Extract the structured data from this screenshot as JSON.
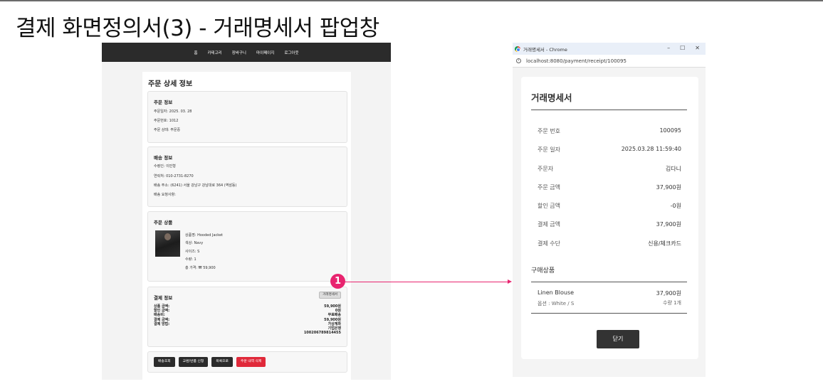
{
  "slide_title": "결제 화면정의서(3) - 거래명세서 팝업창",
  "order_page": {
    "nav": [
      "홈",
      "카테고리",
      "장바구니",
      "마이페이지",
      "로그아웃"
    ],
    "title": "주문 상세 정보",
    "order_info": {
      "title": "주문 정보",
      "lines": [
        "주문일자: 2025. 03. 28",
        "주문번호: 1012",
        "주문 상태: 주문중"
      ]
    },
    "delivery_info": {
      "title": "배송 정보",
      "lines": [
        "수령인: 이민형",
        "연락처: 010-2731-8270",
        "배송 주소: (6241) 서울 강남구 강남대로 364 (역삼동)",
        "배송 요청사항:"
      ]
    },
    "products": {
      "title": "주문 상품",
      "lines": [
        "상품명: Hooded Jacket",
        "색상: Navy",
        "사이즈: S",
        "수량: 1",
        "총 가격: ₩ 59,900"
      ]
    },
    "payment_info": {
      "title": "결제 정보",
      "receipt_button": "거래명세서",
      "labels": [
        "상품 금액:",
        "할인 금액:",
        "배송비:",
        "결제 금액:",
        "결제 방법:"
      ],
      "values": [
        "59,900원",
        "0원",
        "무료배송",
        "59,900원",
        "가상계좌",
        "기업은행",
        "100206789814455"
      ]
    },
    "buttons": [
      "배송조회",
      "교환/반품 신청",
      "목록으로",
      "주문 내역 삭제"
    ]
  },
  "annotation": {
    "badge": "1",
    "color": "#e8246f"
  },
  "popup": {
    "window_title": "거래명세서 - Chrome",
    "window_controls": [
      "–",
      "☐",
      "✕"
    ],
    "url": "localhost:8080/payment/receipt/100095",
    "title": "거래명세서",
    "rows": [
      {
        "label": "주문 번호",
        "value": "100095"
      },
      {
        "label": "주문 일자",
        "value": "2025.03.28 11:59:40"
      },
      {
        "label": "주문자",
        "value": "김다니"
      },
      {
        "label": "주문 금액",
        "value": "37,900원"
      },
      {
        "label": "할인 금액",
        "value": "-0원"
      },
      {
        "label": "결제 금액",
        "value": "37,900원"
      },
      {
        "label": "결제 수단",
        "value": "신용/체크카드"
      }
    ],
    "items_heading": "구매상품",
    "item": {
      "name": "Linen Blouse",
      "price": "37,900원",
      "option": "옵션 : White / S",
      "quantity": "수량 1개"
    },
    "close_button": "닫기"
  }
}
